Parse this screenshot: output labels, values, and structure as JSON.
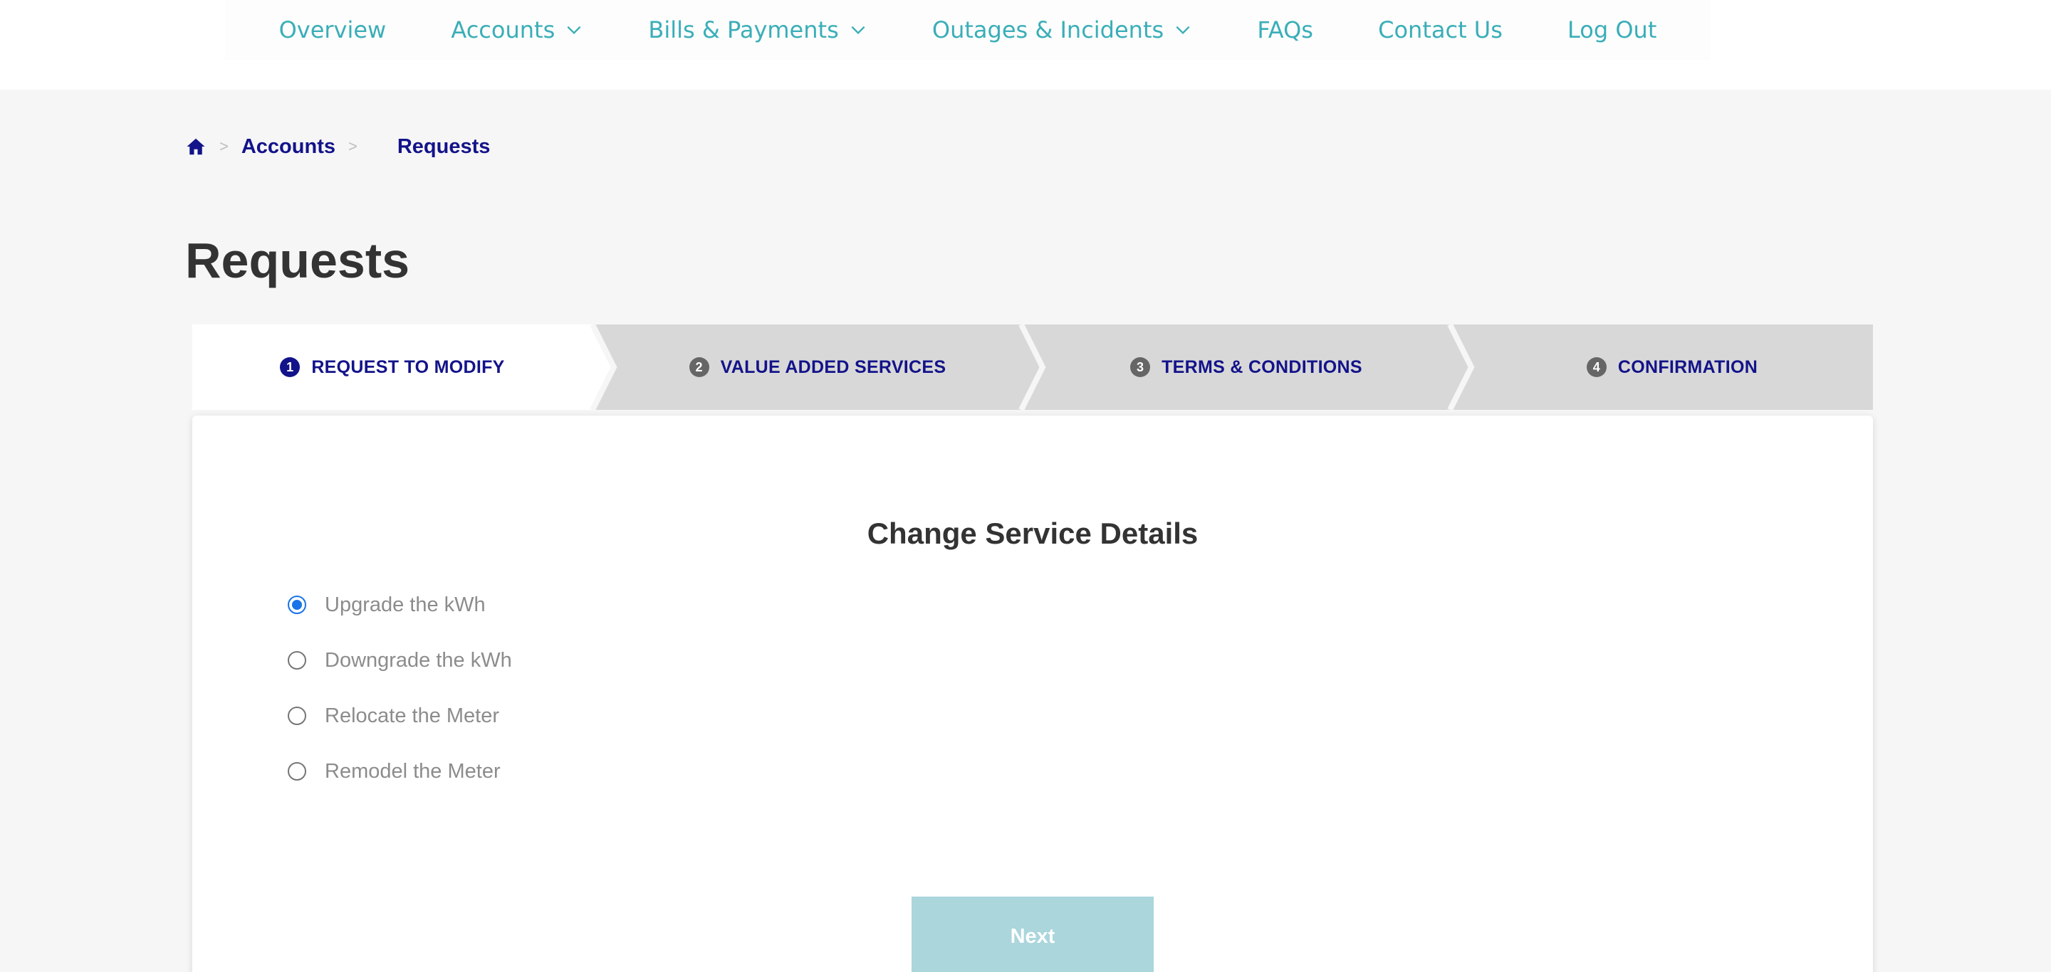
{
  "nav": {
    "items": [
      {
        "label": "Overview",
        "dropdown": false
      },
      {
        "label": "Accounts",
        "dropdown": true
      },
      {
        "label": "Bills & Payments",
        "dropdown": true
      },
      {
        "label": "Outages & Incidents",
        "dropdown": true
      },
      {
        "label": "FAQs",
        "dropdown": false
      },
      {
        "label": "Contact Us",
        "dropdown": false
      },
      {
        "label": "Log Out",
        "dropdown": false
      }
    ],
    "color": "#3aaeb8"
  },
  "breadcrumb": {
    "home_icon": "home-icon",
    "items": [
      "Accounts",
      "Requests"
    ],
    "separator": ">"
  },
  "page": {
    "title": "Requests"
  },
  "stepper": {
    "steps": [
      {
        "number": "1",
        "label": "REQUEST TO MODIFY",
        "active": true
      },
      {
        "number": "2",
        "label": "VALUE ADDED SERVICES",
        "active": false
      },
      {
        "number": "3",
        "label": "TERMS & CONDITIONS",
        "active": false
      },
      {
        "number": "4",
        "label": "CONFIRMATION",
        "active": false
      }
    ]
  },
  "form": {
    "title": "Change Service Details",
    "options": [
      {
        "label": "Upgrade the kWh",
        "checked": true
      },
      {
        "label": "Downgrade the kWh",
        "checked": false
      },
      {
        "label": "Relocate the Meter",
        "checked": false
      },
      {
        "label": "Remodel the Meter",
        "checked": false
      }
    ],
    "next_label": "Next"
  },
  "colors": {
    "brand_navy": "#13138a",
    "accent_teal": "#3aaeb8",
    "button_disabled": "#aad6dc",
    "radio_selected": "#1a73e8"
  }
}
